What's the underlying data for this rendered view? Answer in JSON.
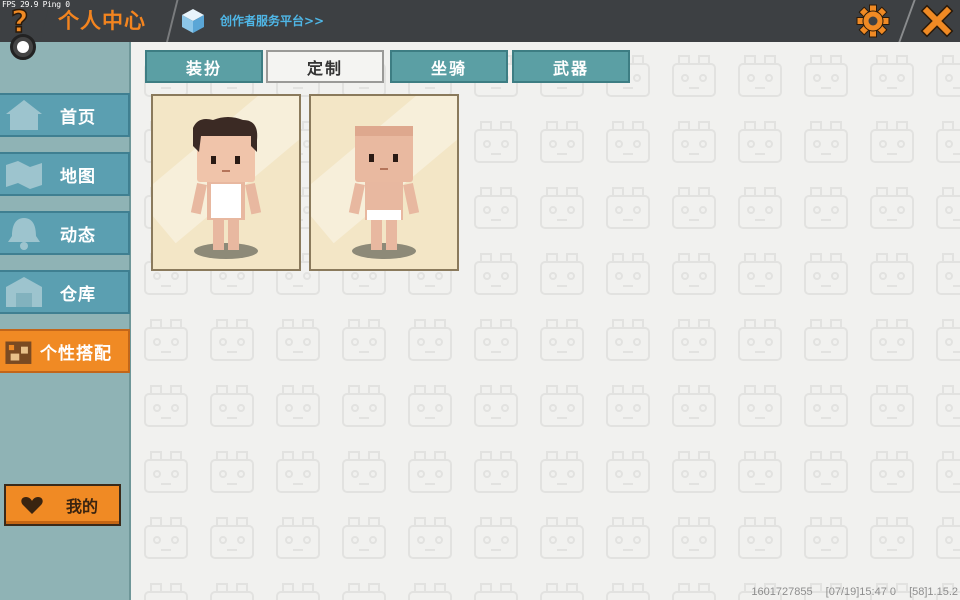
{
  "header": {
    "fps_text": "FPS 29.9  Ping 0",
    "title": "个人中心",
    "creator_link": "创作者服务平台>>"
  },
  "sidebar": {
    "items": [
      {
        "label": "首页",
        "icon": "house-icon"
      },
      {
        "label": "地图",
        "icon": "map-icon"
      },
      {
        "label": "动态",
        "icon": "bell-icon"
      },
      {
        "label": "仓库",
        "icon": "warehouse-icon"
      },
      {
        "label": "个性搭配",
        "icon": "wardrobe-icon",
        "active": true
      }
    ],
    "mine_button": "我的"
  },
  "tabs": [
    {
      "label": "装扮",
      "active": false
    },
    {
      "label": "定制",
      "active": true
    },
    {
      "label": "坐骑",
      "active": false
    },
    {
      "label": "武器",
      "active": false
    }
  ],
  "cards": [
    {
      "name": "character-with-hair"
    },
    {
      "name": "character-bald"
    }
  ],
  "footer": {
    "id": "1601727855",
    "timestamp": "[07/19]15:47 0",
    "version": "[58]1.15.2"
  },
  "colors": {
    "accent": "#f08a24",
    "tab_teal": "#5b9fa4",
    "link": "#4fb6e6",
    "topbar": "#3d4043"
  }
}
